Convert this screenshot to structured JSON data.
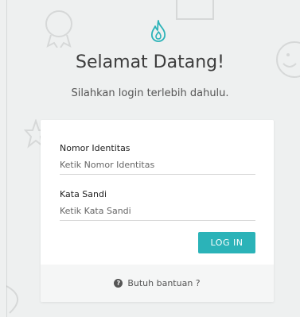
{
  "header": {
    "title": "Selamat Datang!",
    "subtitle": "Silahkan login terlebih dahulu."
  },
  "form": {
    "identity_label": "Nomor Identitas",
    "identity_placeholder": "Ketik Nomor Identitas",
    "password_label": "Kata Sandi",
    "password_placeholder": "Ketik Kata Sandi",
    "login_label": "LOG IN"
  },
  "footer": {
    "help_icon": "?",
    "help_text": "Butuh bantuan ?"
  },
  "colors": {
    "accent": "#2bb3b8",
    "background": "#eef0f0"
  },
  "icons": {
    "logo": "flame-icon",
    "help": "question-circle-icon"
  }
}
